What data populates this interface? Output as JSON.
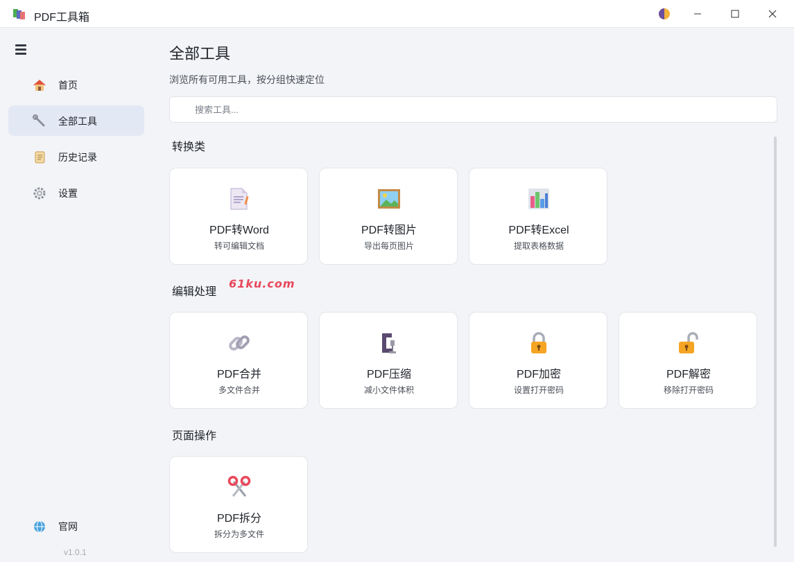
{
  "window": {
    "title": "PDF工具箱"
  },
  "sidebar": {
    "items": [
      {
        "label": "首页",
        "icon": "home-icon"
      },
      {
        "label": "全部工具",
        "icon": "wrench-icon",
        "active": true
      },
      {
        "label": "历史记录",
        "icon": "scroll-icon"
      },
      {
        "label": "设置",
        "icon": "gear-icon"
      }
    ],
    "website": {
      "label": "官网",
      "icon": "globe-icon"
    },
    "version": "v1.0.1"
  },
  "main": {
    "title": "全部工具",
    "subtitle": "浏览所有可用工具，按分组快速定位",
    "search": {
      "placeholder": "搜索工具...",
      "value": ""
    },
    "sections": [
      {
        "title": "转换类",
        "tools": [
          {
            "title": "PDF转Word",
            "desc": "转可编辑文档",
            "icon": "document-icon"
          },
          {
            "title": "PDF转图片",
            "desc": "导出每页图片",
            "icon": "picture-icon"
          },
          {
            "title": "PDF转Excel",
            "desc": "提取表格数据",
            "icon": "bar-chart-icon"
          }
        ]
      },
      {
        "title": "编辑处理",
        "tools": [
          {
            "title": "PDF合并",
            "desc": "多文件合并",
            "icon": "link-icon"
          },
          {
            "title": "PDF压缩",
            "desc": "减小文件体积",
            "icon": "clamp-icon"
          },
          {
            "title": "PDF加密",
            "desc": "设置打开密码",
            "icon": "lock-icon"
          },
          {
            "title": "PDF解密",
            "desc": "移除打开密码",
            "icon": "unlock-icon"
          }
        ]
      },
      {
        "title": "页面操作",
        "tools": [
          {
            "title": "PDF拆分",
            "desc": "拆分为多文件",
            "icon": "scissors-icon"
          }
        ]
      }
    ]
  },
  "watermark": "61ku.com",
  "colors": {
    "active_nav_bg": "#e3e8f5",
    "background": "#f3f4f7",
    "card_bg": "#ffffff",
    "watermark": "#e8475a"
  }
}
